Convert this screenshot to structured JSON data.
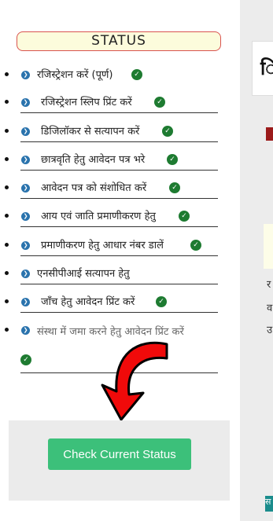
{
  "status": {
    "title": "STATUS",
    "items": [
      {
        "label": "रजिस्ट्रेशन करें (पूर्ण)",
        "checked": true
      },
      {
        "label": "रजिस्ट्रेशन स्लिप प्रिंट करें",
        "checked": true
      },
      {
        "label": "डिजिलॉकर से सत्यापन करें",
        "checked": true
      },
      {
        "label": "छात्रवृति हेतु आवेदन पत्र भरे",
        "checked": true
      },
      {
        "label": "आवेदन पत्र को संशोधित करें",
        "checked": true
      },
      {
        "label": "आय एवं जाति प्रमाणीकरण हेतु",
        "checked": true
      },
      {
        "label": "प्रमाणीकरण हेतु आधार नंबर डालें",
        "checked": true
      },
      {
        "label": "एनसीपीआई सत्यापन हेतु",
        "checked": false
      },
      {
        "label": "जाँच हेतु आवेदन प्रिंट करें",
        "checked": true
      },
      {
        "label": "संस्था में जमा करने हेतु आवेदन प्रिंट करें",
        "checked": true
      }
    ]
  },
  "actions": {
    "check_status_label": "Check Current Status"
  },
  "right_panel": {
    "glyph": "ि",
    "frag1": "र",
    "frag2": "व",
    "frag3": "उ",
    "frag4": "स"
  },
  "colors": {
    "accent_green": "#3cc07a",
    "check_green": "#1e7b31",
    "icon_blue": "#2a73ad",
    "header_border": "#d9534f"
  }
}
